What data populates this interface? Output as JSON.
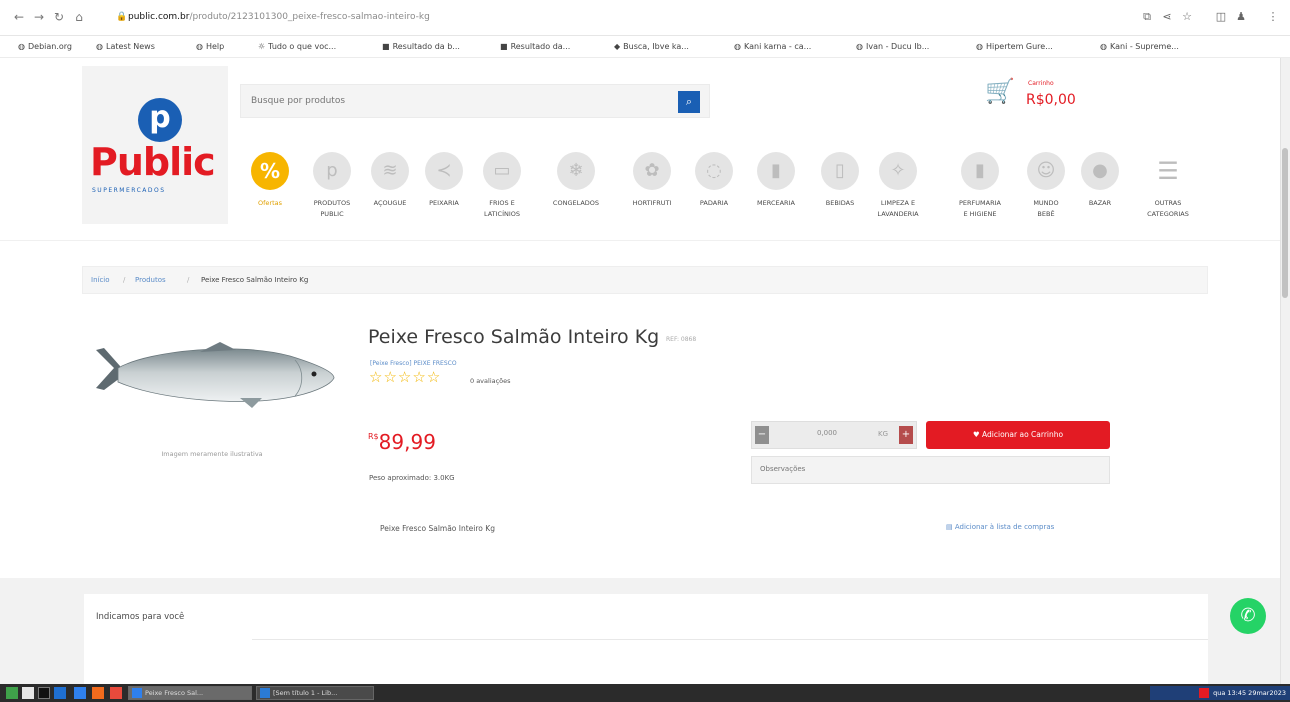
{
  "browser": {
    "url_host": "public.com.br",
    "url_path": "/produto/2123101300_peixe-fresco-salmao-inteiro-kg",
    "bookmarks": [
      "Debian.org",
      "Latest News",
      "Help",
      "Tudo o que voc...",
      "Resultado da b...",
      "Resultado da...",
      "Busca, Ibve ka...",
      "Kani karna - ca...",
      "Ivan - Ducu Ib...",
      "Hipertem Gure...",
      "Kani - Supreme..."
    ]
  },
  "header": {
    "logo_letter": "p",
    "logo_name": "Public",
    "logo_tagline": "SUPERMERCADOS",
    "search_placeholder": "Busque por produtos",
    "cart_label": "Carrinho",
    "cart_total": "R$0,00"
  },
  "categories": [
    {
      "label": "Ofertas",
      "icon": "%"
    },
    {
      "label": "PRODUTOS\nPUBLIC",
      "icon": "p"
    },
    {
      "label": "AÇOUGUE",
      "icon": "≋"
    },
    {
      "label": "PEIXARIA",
      "icon": "≺"
    },
    {
      "label": "FRIOS E\nLATICÍNIOS",
      "icon": "▭"
    },
    {
      "label": "CONGELADOS",
      "icon": "❄"
    },
    {
      "label": "HORTIFRUTI",
      "icon": "✿"
    },
    {
      "label": "PADARIA",
      "icon": "◌"
    },
    {
      "label": "MERCEARIA",
      "icon": "▮"
    },
    {
      "label": "BEBIDAS",
      "icon": "▯"
    },
    {
      "label": "LIMPEZA E\nLAVANDERIA",
      "icon": "✧"
    },
    {
      "label": "PERFUMARIA\nE HIGIENE",
      "icon": "▮"
    },
    {
      "label": "MUNDO\nBEBÊ",
      "icon": "☺"
    },
    {
      "label": "BAZAR",
      "icon": "●"
    },
    {
      "label": "OUTRAS\nCATEGORIAS",
      "icon": "☰"
    }
  ],
  "breadcrumb": {
    "home": "Início",
    "products": "Produtos",
    "current": "Peixe Fresco Salmão Inteiro Kg"
  },
  "product": {
    "image_note": "Imagem meramente ilustrativa",
    "title": "Peixe Fresco Salmão Inteiro Kg",
    "ref": "REF: 0868",
    "department": "[Peixe Fresco] PEIXE FRESCO",
    "stars_filled": 0,
    "reviews": "0 avaliações",
    "currency": "R$",
    "price": "89,99",
    "weight": "Peso aproximado: 3.0KG",
    "qty_value": "0,000",
    "qty_unit": "KG",
    "add_to_cart": "Adicionar ao Carrinho",
    "obs_placeholder": "Observações",
    "name_small": "Peixe Fresco Salmão Inteiro Kg",
    "add_list": "Adicionar à lista de compras"
  },
  "recommendations": {
    "tab_label": "Indicamos para você"
  },
  "taskbar": {
    "tasks": [
      "Peixe Fresco Sal...",
      "[Sem título 1 - Lib..."
    ],
    "clock": "qua 13:45 29mar2023"
  },
  "colors": {
    "brand_red": "#e31b23",
    "brand_blue": "#1a5fb4",
    "offer_yellow": "#f7b500",
    "whatsapp_green": "#25d366"
  }
}
